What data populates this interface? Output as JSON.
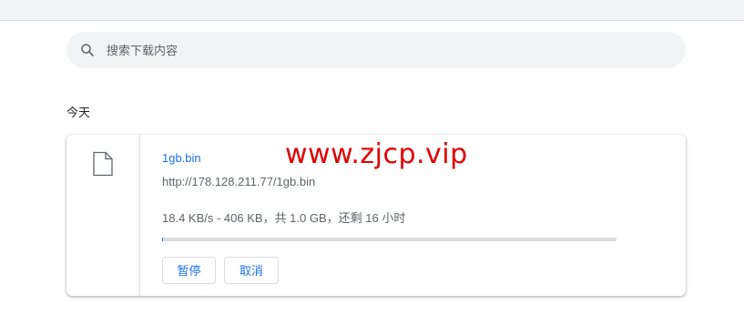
{
  "search": {
    "placeholder": "搜索下载内容",
    "icon": "search-icon"
  },
  "section": {
    "title": "今天"
  },
  "download": {
    "file_icon": "file-icon",
    "file_name": "1gb.bin",
    "url": "http://178.128.211.77/1gb.bin",
    "status": "18.4 KB/s - 406 KB，共 1.0 GB，还剩 16 小时",
    "progress_fraction": 0.0004,
    "pause_label": "暂停",
    "cancel_label": "取消"
  },
  "watermark": {
    "text": "www.zjcp.vip",
    "color": "#e00000"
  },
  "colors": {
    "accent": "#1a73e8",
    "secondary_text": "#5f6368",
    "surface": "#f1f3f4"
  }
}
